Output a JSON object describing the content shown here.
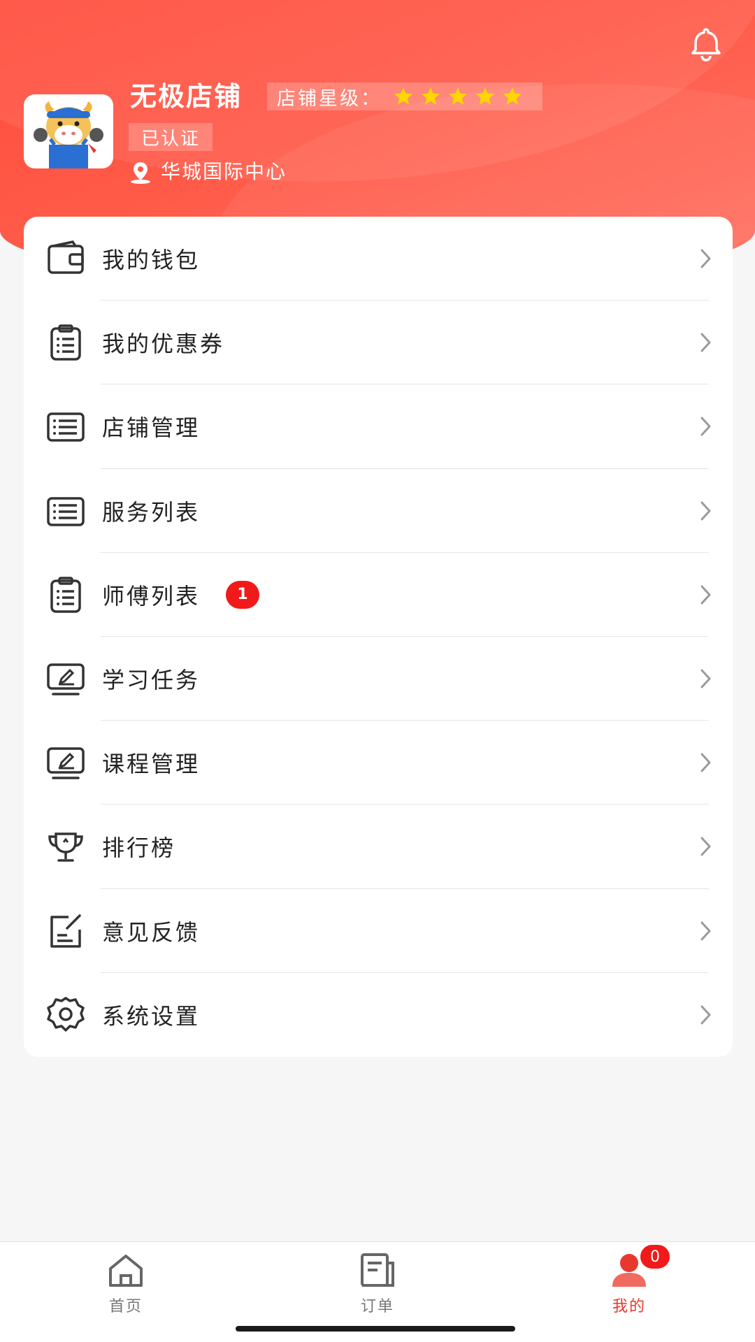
{
  "colors": {
    "header_red": "#ff4d3d",
    "badge_red": "#f11a1a",
    "active_tab": "#e8382d",
    "star_yellow": "#ffd600"
  },
  "header": {
    "shop_name": "无极店铺",
    "rating_label": "店铺星级：",
    "rating_stars": 5,
    "certified": "已认证",
    "location": "华城国际中心",
    "bell_icon": "bell-icon",
    "avatar_icon": "cartoon-ox-avatar"
  },
  "menu": {
    "items": [
      {
        "label": "我的钱包",
        "icon": "wallet-icon"
      },
      {
        "label": "我的优惠券",
        "icon": "clipboard-list-icon"
      },
      {
        "label": "店铺管理",
        "icon": "list-icon"
      },
      {
        "label": "服务列表",
        "icon": "list-icon"
      },
      {
        "label": "师傅列表",
        "icon": "clipboard-list-icon",
        "badge": "1"
      },
      {
        "label": "学习任务",
        "icon": "monitor-pen-icon"
      },
      {
        "label": "课程管理",
        "icon": "monitor-pen-icon"
      },
      {
        "label": "排行榜",
        "icon": "trophy-icon"
      },
      {
        "label": "意见反馈",
        "icon": "edit-note-icon"
      },
      {
        "label": "系统设置",
        "icon": "gear-icon"
      }
    ]
  },
  "tabbar": {
    "tabs": [
      {
        "label": "首页",
        "icon": "home-icon"
      },
      {
        "label": "订单",
        "icon": "order-icon"
      },
      {
        "label": "我的",
        "icon": "user-icon",
        "badge": "0",
        "active": true
      }
    ]
  }
}
